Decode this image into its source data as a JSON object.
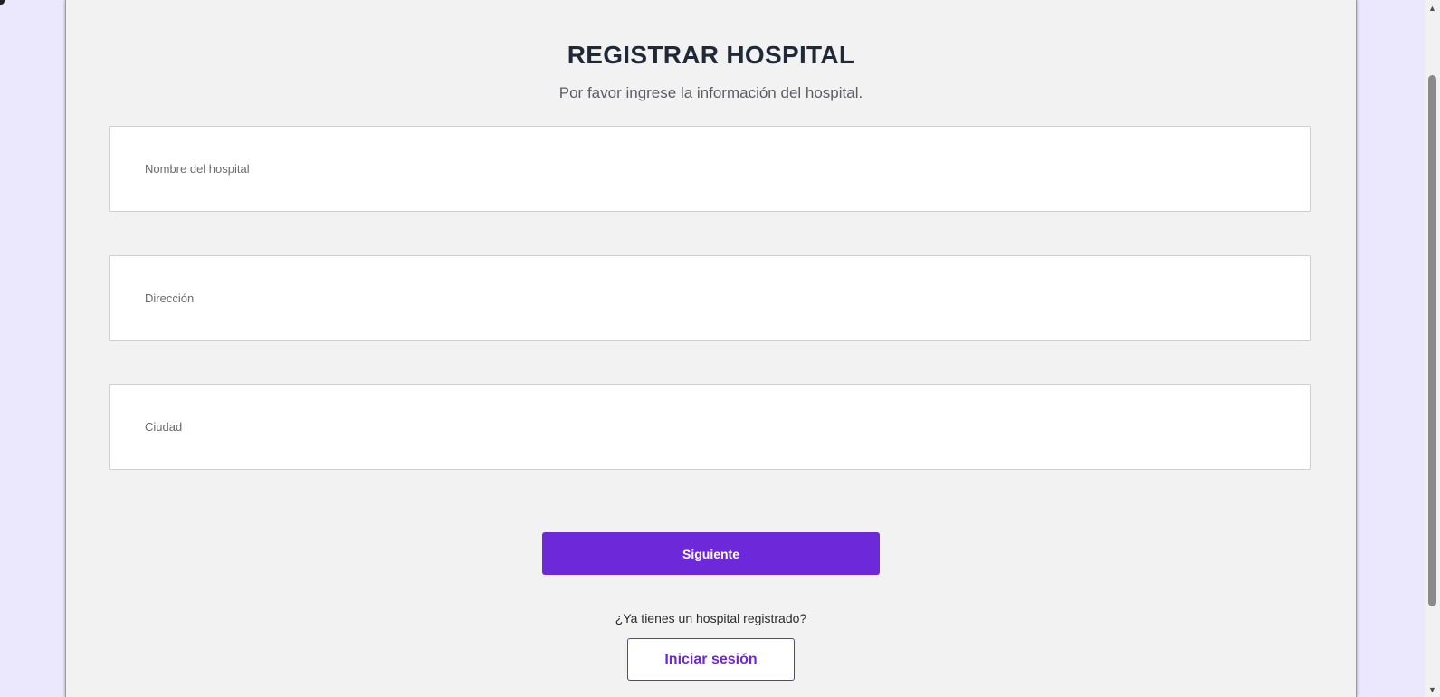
{
  "form": {
    "title": "REGISTRAR HOSPITAL",
    "subtitle": "Por favor ingrese la información del hospital.",
    "fields": [
      {
        "placeholder": "Nombre del hospital",
        "value": ""
      },
      {
        "placeholder": "Dirección",
        "value": ""
      },
      {
        "placeholder": "Ciudad",
        "value": ""
      }
    ],
    "submit_label": "Siguiente",
    "login_prompt": "¿Ya tienes un hospital registrado?",
    "login_label": "Iniciar sesión"
  },
  "scrollbar": {
    "up_icon": "▲",
    "down_icon": "▼"
  },
  "colors": {
    "accent": "#6d28d9",
    "page_background": "#ebe7fd",
    "card_background": "#f2f2f2",
    "title": "#1f2937"
  }
}
